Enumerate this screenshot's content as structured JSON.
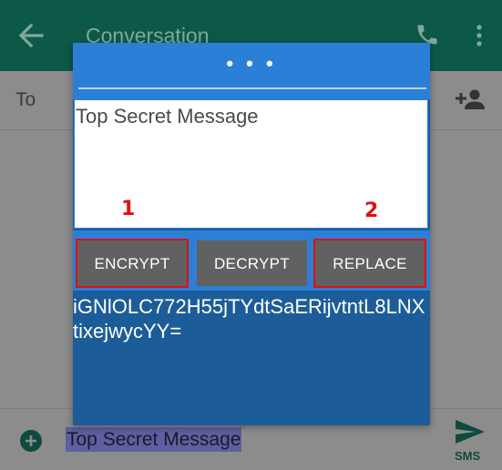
{
  "appbar": {
    "title": "Conversation",
    "icons": {
      "back": "arrow-back-icon",
      "call": "phone-icon",
      "menu": "more-vert-icon"
    }
  },
  "recipient": {
    "label": "To",
    "icon": "add-person-icon"
  },
  "compose": {
    "draft_text": "Top Secret Message",
    "send_label": "SMS",
    "icons": {
      "attach": "add-circle-icon",
      "send": "send-icon"
    }
  },
  "dialog": {
    "handle": "• • •",
    "input_text": "Top Secret Message",
    "buttons": {
      "encrypt": "ENCRYPT",
      "decrypt": "DECRYPT",
      "replace": "REPLACE"
    },
    "output_text": "iGNlOLC772H55jTYdtSaERijvtntL8LNXtixejwycYY=",
    "annotations": {
      "first": "1",
      "second": "2"
    }
  },
  "colors": {
    "appbar": "#0d5947",
    "dialog_header": "#2c7fd7",
    "dialog_body": "#1c5d99",
    "button": "#616161",
    "annotation": "#e01010"
  }
}
